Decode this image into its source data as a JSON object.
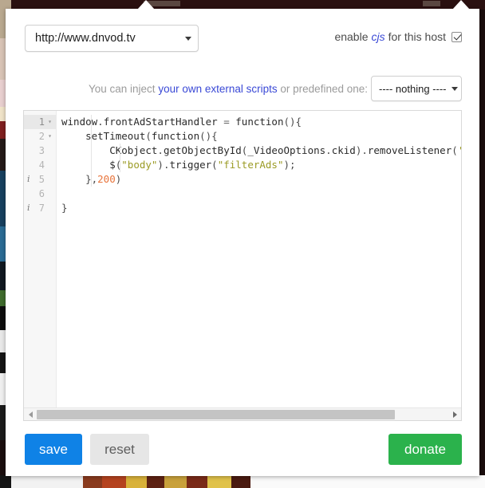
{
  "popup": {
    "host_select": {
      "value": "http://www.dnvod.tv",
      "caret_icon": "chevron-down-icon"
    },
    "enable_host": {
      "prefix": "enable",
      "keyword": "cjs",
      "suffix": "for this host",
      "checked": true
    },
    "inject": {
      "prefix": "You can inject",
      "link": "your own external scripts",
      "suffix": "or predefined one:",
      "select_value": "---- nothing ----",
      "caret_icon": "chevron-down-icon"
    },
    "editor": {
      "active_line": 1,
      "lines": [
        {
          "num": "1",
          "fold": "▾",
          "anno": "",
          "active": true,
          "indent": 0,
          "tokens": [
            {
              "t": "window",
              "c": "t-plain"
            },
            {
              "t": ".",
              "c": "t-punc"
            },
            {
              "t": "frontAdStartHandler",
              "c": "t-prop"
            },
            {
              "t": " = ",
              "c": "t-op"
            },
            {
              "t": "function",
              "c": "t-kw"
            },
            {
              "t": "(){",
              "c": "t-punc"
            }
          ]
        },
        {
          "num": "2",
          "fold": "▾",
          "anno": "",
          "active": false,
          "indent": 1,
          "tokens": [
            {
              "t": "    setTimeout",
              "c": "t-plain"
            },
            {
              "t": "(",
              "c": "t-punc"
            },
            {
              "t": "function",
              "c": "t-kw"
            },
            {
              "t": "(){",
              "c": "t-punc"
            }
          ]
        },
        {
          "num": "3",
          "fold": "",
          "anno": "",
          "active": false,
          "indent": 2,
          "tokens": [
            {
              "t": "        CKobject",
              "c": "t-plain"
            },
            {
              "t": ".",
              "c": "t-punc"
            },
            {
              "t": "getObjectById",
              "c": "t-prop"
            },
            {
              "t": "(",
              "c": "t-punc"
            },
            {
              "t": "_VideoOptions",
              "c": "t-plain"
            },
            {
              "t": ".",
              "c": "t-punc"
            },
            {
              "t": "ckid",
              "c": "t-prop"
            },
            {
              "t": ").",
              "c": "t-punc"
            },
            {
              "t": "removeListener",
              "c": "t-prop"
            },
            {
              "t": "(",
              "c": "t-punc"
            },
            {
              "t": "'frontAdSt",
              "c": "t-str"
            }
          ]
        },
        {
          "num": "4",
          "fold": "",
          "anno": "",
          "active": false,
          "indent": 2,
          "tokens": [
            {
              "t": "        $",
              "c": "t-plain"
            },
            {
              "t": "(",
              "c": "t-punc"
            },
            {
              "t": "\"body\"",
              "c": "t-str"
            },
            {
              "t": ").",
              "c": "t-punc"
            },
            {
              "t": "trigger",
              "c": "t-prop"
            },
            {
              "t": "(",
              "c": "t-punc"
            },
            {
              "t": "\"filterAds\"",
              "c": "t-str"
            },
            {
              "t": ");",
              "c": "t-punc"
            }
          ]
        },
        {
          "num": "5",
          "fold": "",
          "anno": "i",
          "active": false,
          "indent": 0,
          "tokens": [
            {
              "t": "    },",
              "c": "t-punc"
            },
            {
              "t": "200",
              "c": "t-num"
            },
            {
              "t": ")",
              "c": "t-punc"
            }
          ]
        },
        {
          "num": "6",
          "fold": "",
          "anno": "",
          "active": false,
          "indent": 0,
          "tokens": []
        },
        {
          "num": "7",
          "fold": "",
          "anno": "i",
          "active": false,
          "indent": 0,
          "tokens": [
            {
              "t": "}",
              "c": "t-punc"
            }
          ]
        }
      ],
      "scrollbar": {
        "left_arrow_icon": "triangle-left-icon",
        "right_arrow_icon": "triangle-right-icon",
        "thumb_width_pct": 87
      }
    },
    "footer": {
      "save_label": "save",
      "reset_label": "reset",
      "donate_label": "donate"
    },
    "colors": {
      "save": "#0f82e6",
      "reset": "#e6e6e6",
      "donate": "#2bb24c",
      "link": "#3a49d6",
      "string_token": "#9b9b25",
      "number_token": "#e8743b"
    }
  }
}
